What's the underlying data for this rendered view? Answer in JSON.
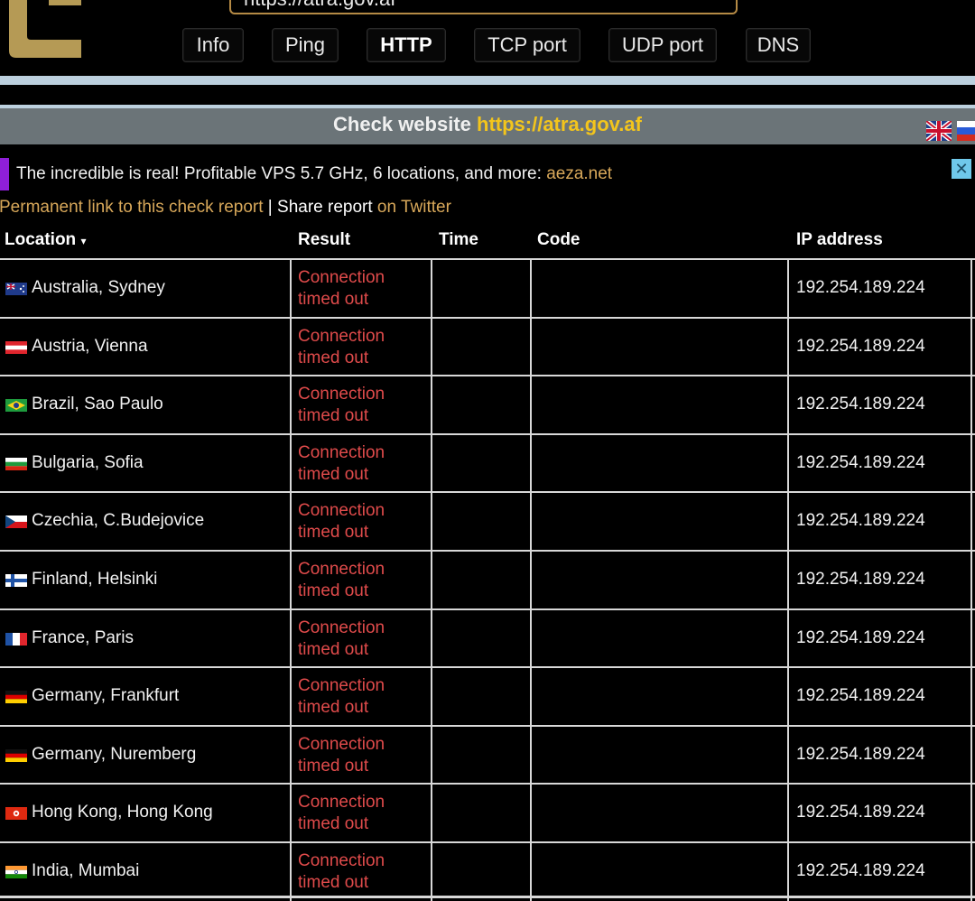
{
  "header": {
    "url_value": "https://atra.gov.af",
    "tabs": [
      {
        "label": "Info",
        "active": false
      },
      {
        "label": "Ping",
        "active": false
      },
      {
        "label": "HTTP",
        "active": true
      },
      {
        "label": "TCP port",
        "active": false
      },
      {
        "label": "UDP port",
        "active": false
      },
      {
        "label": "DNS",
        "active": false
      }
    ]
  },
  "title": {
    "prefix": "Check website ",
    "url": "https://atra.gov.af"
  },
  "ad": {
    "text": "The incredible is real! Profitable VPS 5.7 GHz, 6 locations, and more: ",
    "link": "aeza.net",
    "close": "✕"
  },
  "share": {
    "permanent_link": "Permanent link to this check report",
    "separator": " | ",
    "share_report": "Share report",
    "twitter": " on Twitter"
  },
  "table": {
    "headers": {
      "location": "Location",
      "sort_arrow": "▾",
      "result": "Result",
      "time": "Time",
      "code": "Code",
      "ip": "IP address"
    },
    "rows": [
      {
        "location": "Australia, Sydney",
        "result_line1": "Connection",
        "result_line2": "timed out",
        "time": "",
        "code": "",
        "ip": "192.254.189.224",
        "flag": "australia"
      },
      {
        "location": "Austria, Vienna",
        "result_line1": "Connection",
        "result_line2": "timed out",
        "time": "",
        "code": "",
        "ip": "192.254.189.224",
        "flag": "austria"
      },
      {
        "location": "Brazil, Sao Paulo",
        "result_line1": "Connection",
        "result_line2": "timed out",
        "time": "",
        "code": "",
        "ip": "192.254.189.224",
        "flag": "brazil"
      },
      {
        "location": "Bulgaria, Sofia",
        "result_line1": "Connection",
        "result_line2": "timed out",
        "time": "",
        "code": "",
        "ip": "192.254.189.224",
        "flag": "bulgaria"
      },
      {
        "location": "Czechia, C.Budejovice",
        "result_line1": "Connection",
        "result_line2": "timed out",
        "time": "",
        "code": "",
        "ip": "192.254.189.224",
        "flag": "czechia"
      },
      {
        "location": "Finland, Helsinki",
        "result_line1": "Connection",
        "result_line2": "timed out",
        "time": "",
        "code": "",
        "ip": "192.254.189.224",
        "flag": "finland"
      },
      {
        "location": "France, Paris",
        "result_line1": "Connection",
        "result_line2": "timed out",
        "time": "",
        "code": "",
        "ip": "192.254.189.224",
        "flag": "france"
      },
      {
        "location": "Germany, Frankfurt",
        "result_line1": "Connection",
        "result_line2": "timed out",
        "time": "",
        "code": "",
        "ip": "192.254.189.224",
        "flag": "germany"
      },
      {
        "location": "Germany, Nuremberg",
        "result_line1": "Connection",
        "result_line2": "timed out",
        "time": "",
        "code": "",
        "ip": "192.254.189.224",
        "flag": "germany"
      },
      {
        "location": "Hong Kong, Hong Kong",
        "result_line1": "Connection",
        "result_line2": "timed out",
        "time": "",
        "code": "",
        "ip": "192.254.189.224",
        "flag": "hongkong"
      },
      {
        "location": "India, Mumbai",
        "result_line1": "Connection",
        "result_line2": "timed out",
        "time": "",
        "code": "",
        "ip": "192.254.189.224",
        "flag": "india"
      }
    ]
  },
  "colors": {
    "accent_gold": "#f3c51c",
    "link_gold": "#d8a85a",
    "error_red": "#e04b4b",
    "title_band": "#6b7478",
    "ad_marker": "#8f1fd8"
  }
}
